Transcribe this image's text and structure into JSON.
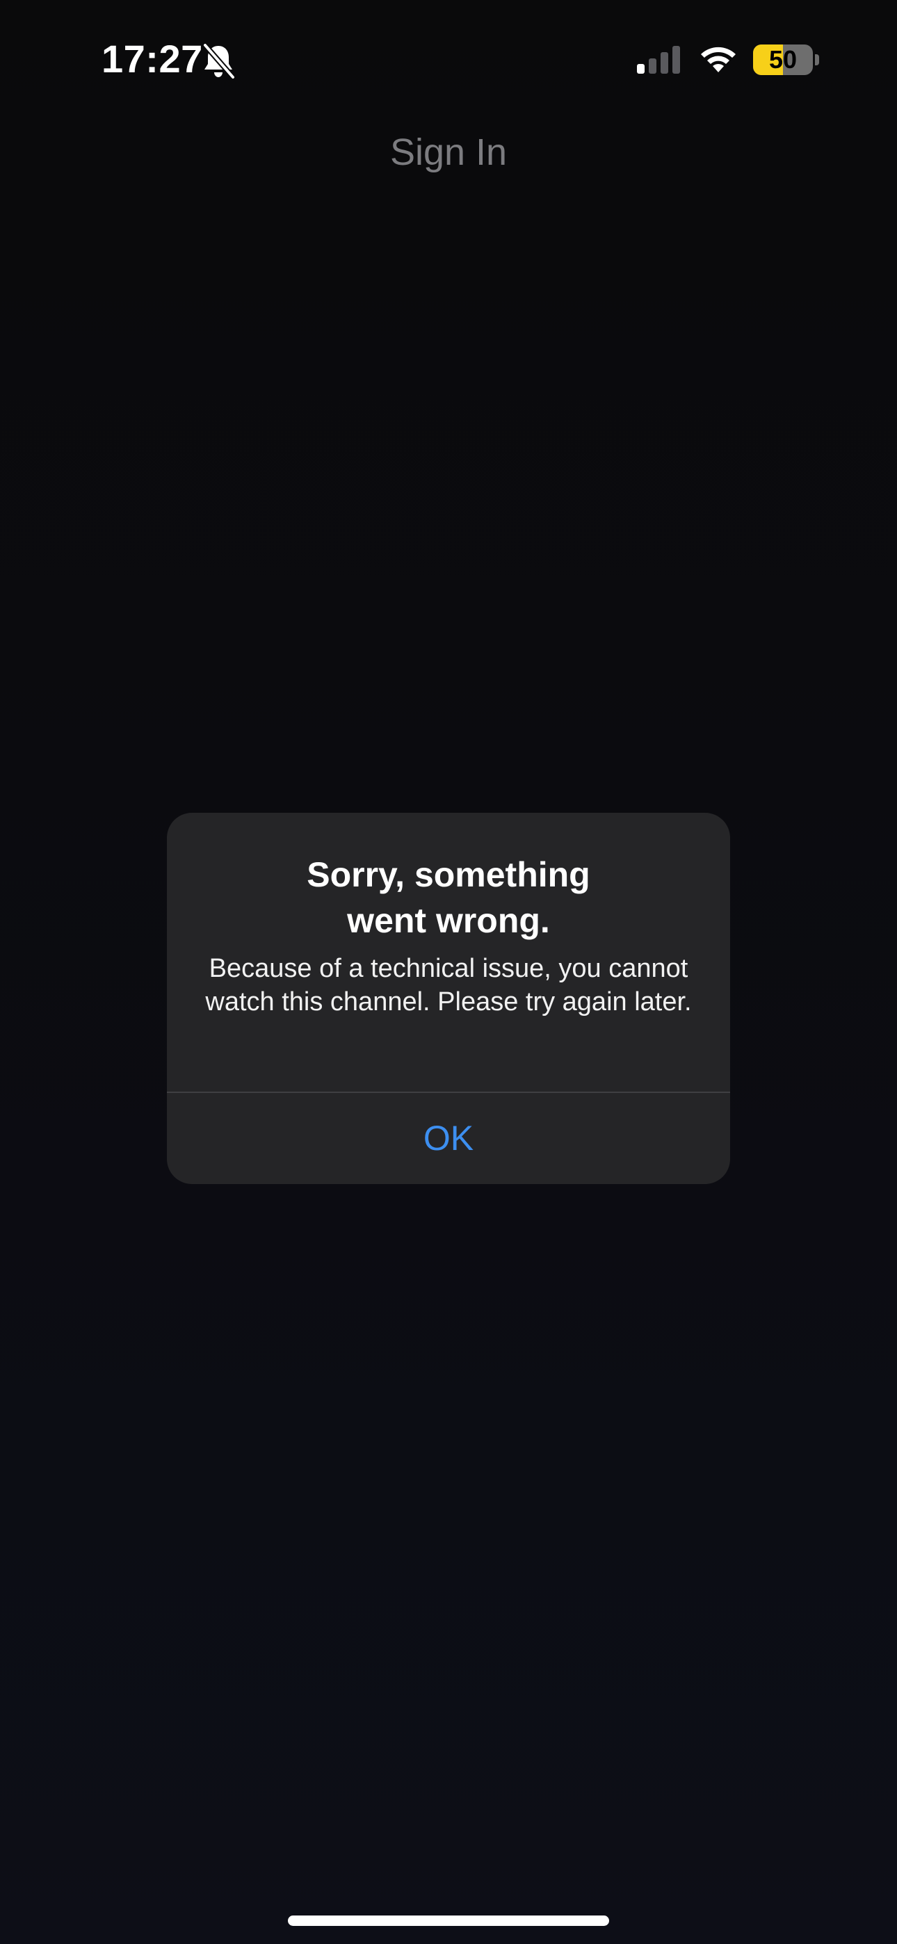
{
  "status_bar": {
    "time": "17:27",
    "battery_level": "50",
    "battery_fraction": 0.5,
    "icons": [
      "bell-slash-icon",
      "cellular-signal-icon",
      "wifi-icon",
      "battery-icon"
    ]
  },
  "header": {
    "title": "Sign In"
  },
  "alert": {
    "title": "Sorry, something went wrong.",
    "message": "Because of a technical issue, you cannot watch this channel. Please try again later.",
    "ok_label": "OK"
  },
  "colors": {
    "background": "#0b0b0f",
    "alert_background": "#252527",
    "accent": "#3d8ff0",
    "battery_yellow": "#f7d019",
    "title_gray": "#7c7c80"
  }
}
